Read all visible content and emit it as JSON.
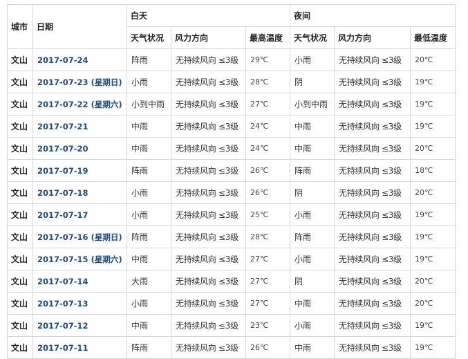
{
  "headers": {
    "city": "城市",
    "date": "日期",
    "day": "白天",
    "night": "夜间",
    "day_cols": [
      "天气状况",
      "风力方向",
      "最高温度"
    ],
    "night_cols": [
      "天气状况",
      "风力方向",
      "最低温度"
    ]
  },
  "rows": [
    {
      "city": "文山",
      "date": "2017-07-24",
      "day_weather": "阵雨",
      "day_wind": "无持续风向 ≤3级",
      "high": "29℃",
      "night_weather": "小雨",
      "night_wind": "无持续风向 ≤3级",
      "low": "20℃"
    },
    {
      "city": "文山",
      "date": "2017-07-23 (星期日)",
      "day_weather": "小雨",
      "day_wind": "无持续风向 ≤3级",
      "high": "28℃",
      "night_weather": "阴",
      "night_wind": "无持续风向 ≤3级",
      "low": "19℃"
    },
    {
      "city": "文山",
      "date": "2017-07-22 (星期六)",
      "day_weather": "小到中雨",
      "day_wind": "无持续风向 ≤3级",
      "high": "27℃",
      "night_weather": "小到中雨",
      "night_wind": "无持续风向 ≤3级",
      "low": "19℃"
    },
    {
      "city": "文山",
      "date": "2017-07-21",
      "day_weather": "中雨",
      "day_wind": "无持续风向 ≤3级",
      "high": "24℃",
      "night_weather": "中雨",
      "night_wind": "无持续风向 ≤3级",
      "low": "19℃"
    },
    {
      "city": "文山",
      "date": "2017-07-20",
      "day_weather": "中雨",
      "day_wind": "无持续风向 ≤3级",
      "high": "24℃",
      "night_weather": "中雨",
      "night_wind": "无持续风向 ≤3级",
      "low": "20℃"
    },
    {
      "city": "文山",
      "date": "2017-07-19",
      "day_weather": "阵雨",
      "day_wind": "无持续风向 ≤3级",
      "high": "26℃",
      "night_weather": "阵雨",
      "night_wind": "无持续风向 ≤3级",
      "low": "18℃"
    },
    {
      "city": "文山",
      "date": "2017-07-18",
      "day_weather": "小雨",
      "day_wind": "无持续风向 ≤3级",
      "high": "26℃",
      "night_weather": "阴",
      "night_wind": "无持续风向 ≤3级",
      "low": "20℃"
    },
    {
      "city": "文山",
      "date": "2017-07-17",
      "day_weather": "小雨",
      "day_wind": "无持续风向 ≤3级",
      "high": "25℃",
      "night_weather": "小雨",
      "night_wind": "无持续风向 ≤3级",
      "low": "19℃"
    },
    {
      "city": "文山",
      "date": "2017-07-16 (星期日)",
      "day_weather": "阵雨",
      "day_wind": "无持续风向 ≤3级",
      "high": "28℃",
      "night_weather": "阵雨",
      "night_wind": "无持续风向 ≤3级",
      "low": "19℃"
    },
    {
      "city": "文山",
      "date": "2017-07-15 (星期六)",
      "day_weather": "中雨",
      "day_wind": "无持续风向 ≤3级",
      "high": "27℃",
      "night_weather": "小雨",
      "night_wind": "无持续风向 ≤3级",
      "low": "19℃"
    },
    {
      "city": "文山",
      "date": "2017-07-14",
      "day_weather": "大雨",
      "day_wind": "无持续风向 ≤3级",
      "high": "27℃",
      "night_weather": "阴",
      "night_wind": "无持续风向 ≤3级",
      "low": "20℃"
    },
    {
      "city": "文山",
      "date": "2017-07-13",
      "day_weather": "小雨",
      "day_wind": "无持续风向 ≤3级",
      "high": "27℃",
      "night_weather": "中雨",
      "night_wind": "无持续风向 ≤3级",
      "low": "20℃"
    },
    {
      "city": "文山",
      "date": "2017-07-12",
      "day_weather": "中雨",
      "day_wind": "无持续风向 ≤3级",
      "high": "23℃",
      "night_weather": "小雨",
      "night_wind": "无持续风向 ≤3级",
      "low": "19℃"
    },
    {
      "city": "文山",
      "date": "2017-07-11",
      "day_weather": "阵雨",
      "day_wind": "无持续风向 ≤3级",
      "high": "26℃",
      "night_weather": "中雨",
      "night_wind": "无持续风向 ≤3级",
      "low": "19℃"
    }
  ]
}
